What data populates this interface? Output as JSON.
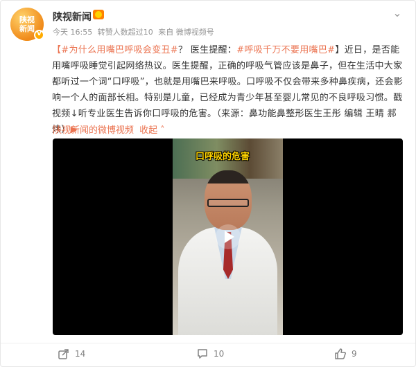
{
  "post": {
    "author": {
      "name": "陕视新闻",
      "avatar_text": "陕视\n新闻",
      "verified": true
    },
    "meta": {
      "time": "今天 16:55",
      "repost_note": "转赞人数超过10",
      "source": "来自 微博视频号"
    },
    "text": {
      "tag1": "【#为什么用嘴巴呼吸会变丑#",
      "part1": "？ 医生提醒：",
      "tag2": "#呼吸千万不要用嘴巴#",
      "part2": "】近日，是否能用嘴呼吸睡觉引起网络热议。医生提醒，正确的呼吸气管应该是鼻子，但在生活中大家都听过一个词“口呼吸”，也就是用嘴巴来呼吸。口呼吸不仅会带来多种鼻疾病，还会影响一个人的面部长相。特别是儿童，已经成为青少年甚至婴儿常见的不良呼吸习惯。戳视频↓听专业医生告诉你口呼吸的危害。（来源：鼻功能鼻整形医生王彤 编辑 王晴 郝炜）",
      "video_link": "▶"
    },
    "source_link": {
      "label": "陕视新闻的微博视频",
      "collapse": "收起"
    },
    "video": {
      "overlay_title": "口呼吸的危害"
    },
    "actions": {
      "reposts": "14",
      "comments": "10",
      "likes": "9"
    }
  },
  "colors": {
    "accent": "#eb7350",
    "muted": "#939393"
  }
}
